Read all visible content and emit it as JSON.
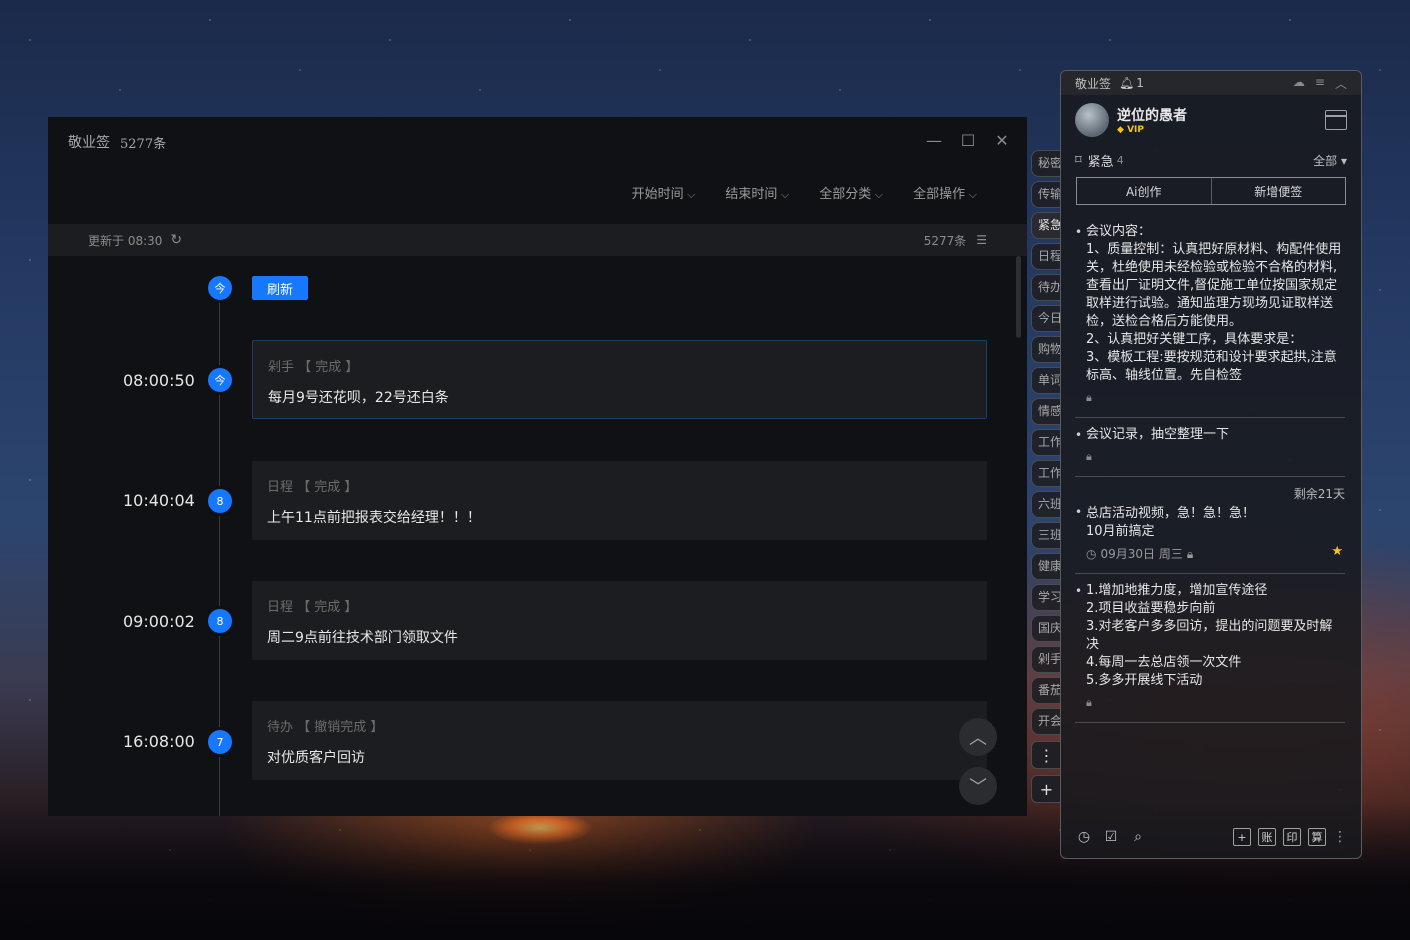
{
  "main": {
    "title": "敬业签",
    "count": "5277条",
    "filters": [
      "开始时间",
      "结束时间",
      "全部分类",
      "全部操作"
    ],
    "updated": "更新于 08:30",
    "total": "5277条",
    "today_badge": "今",
    "refresh_label": "刷新",
    "entries": [
      {
        "time": "08:00:50",
        "badge": "今",
        "category": "剁手",
        "status": "完成",
        "text": "每月9号还花呗，22号还白条"
      },
      {
        "time": "10:40:04",
        "badge": "8",
        "category": "日程",
        "status": "完成",
        "text": "上午11点前把报表交给经理！！！"
      },
      {
        "time": "09:00:02",
        "badge": "8",
        "category": "日程",
        "status": "完成",
        "text": "周二9点前往技术部门领取文件"
      },
      {
        "time": "16:08:00",
        "badge": "7",
        "category": "待办",
        "status": "撤销完成",
        "text": "对优质客户回访"
      }
    ]
  },
  "tabs": [
    "秘密",
    "传输",
    "紧急",
    "日程",
    "待办",
    "今日",
    "购物",
    "单词",
    "情感",
    "工作",
    "工作",
    "六班",
    "三班",
    "健康",
    "学习",
    "国庆",
    "剁手",
    "番茄",
    "开会"
  ],
  "tab_more": "⋮",
  "tab_add": "+",
  "panel": {
    "header": {
      "title": "敬业签",
      "reminder_count": "1"
    },
    "user": {
      "name": "逆位的愚者",
      "vip": "VIP"
    },
    "category": {
      "name": "紧急",
      "count": "4",
      "all": "全部"
    },
    "ai_button": "Ai创作",
    "new_button": "新增便签",
    "notes": [
      {
        "text": "会议内容：\n1、质量控制：认真把好原材料、构配件使用关，杜绝使用未经检验或检验不合格的材料,查看出厂证明文件,督促施工单位按国家规定取样进行试验。通知监理方现场见证取样送检，送检合格后方能使用。\n2、认真把好关键工序，具体要求是：\n3、模板工程:要按规范和设计要求起拱,注意标高、轴线位置。先自检签"
      },
      {
        "text": "会议记录，抽空整理一下"
      },
      {
        "remaining": "剩余21天",
        "text": "总店活动视频，急！急！急！\n10月前搞定",
        "date": "09月30日 周三"
      },
      {
        "text": "1.增加地推力度，增加宣传途径\n2.项目收益要稳步向前\n3.对老客户多多回访，提出的问题要及时解决\n4.每周一去总店领一次文件\n5.多多开展线下活动"
      }
    ],
    "footer_buttons": [
      "+",
      "账",
      "印",
      "算"
    ]
  }
}
